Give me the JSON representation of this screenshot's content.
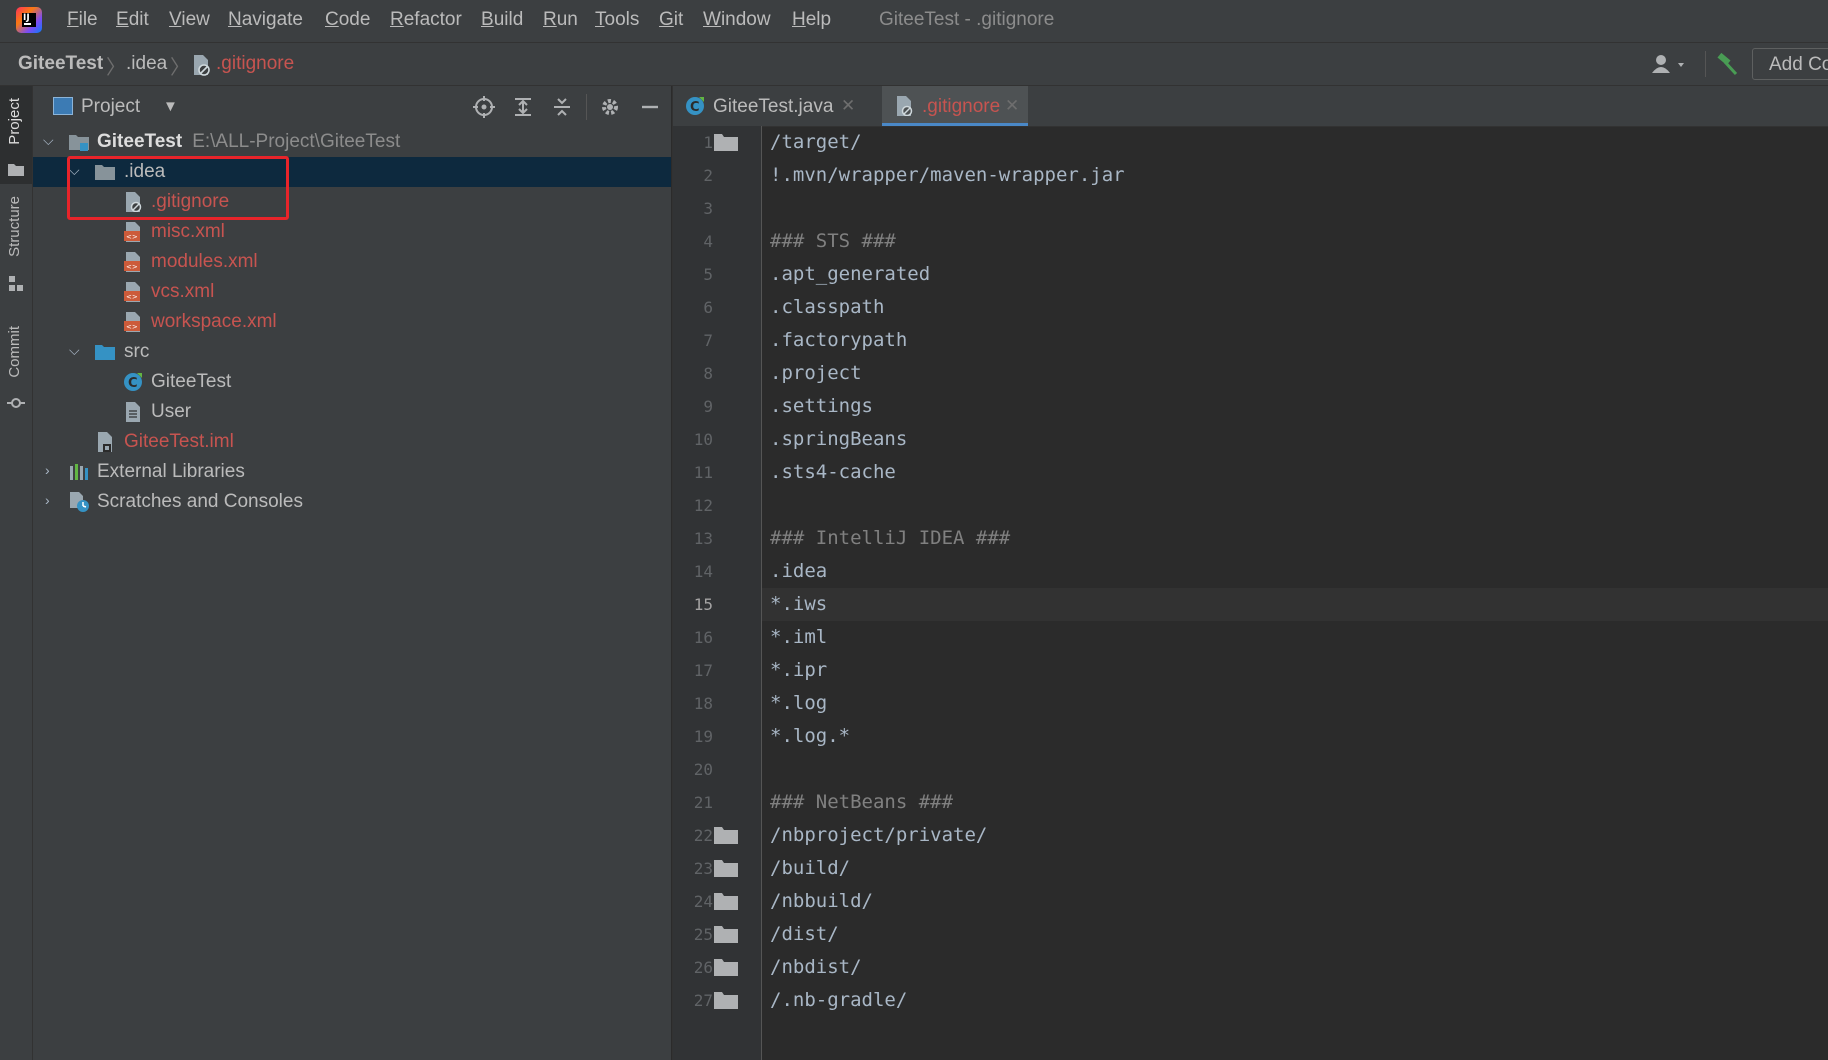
{
  "menubar": {
    "items": [
      {
        "mnemonic": "F",
        "rest": "ile"
      },
      {
        "mnemonic": "E",
        "rest": "dit"
      },
      {
        "mnemonic": "V",
        "rest": "iew"
      },
      {
        "mnemonic": "N",
        "rest": "avigate"
      },
      {
        "mnemonic": "C",
        "rest": "ode"
      },
      {
        "mnemonic": "R",
        "rest": "efactor"
      },
      {
        "mnemonic": "B",
        "rest": "uild"
      },
      {
        "mnemonic": "R",
        "rest": "un"
      },
      {
        "mnemonic": "T",
        "rest": "ools"
      },
      {
        "mnemonic": "G",
        "rest": "it"
      },
      {
        "mnemonic": "W",
        "rest": "indow"
      },
      {
        "mnemonic": "H",
        "rest": "elp"
      }
    ],
    "window_title": "GiteeTest - .gitignore"
  },
  "navbar": {
    "crumbs": [
      "GiteeTest",
      ".idea",
      ".gitignore"
    ],
    "add_config_label": "Add Co"
  },
  "tool_stripe": {
    "project": "Project",
    "structure": "Structure",
    "commit": "Commit"
  },
  "project_panel": {
    "title": "Project",
    "tree": [
      {
        "label": "GiteeTest",
        "path": "E:\\ALL-Project\\GiteeTest",
        "icon": "module-folder-icon"
      },
      {
        "label": ".idea",
        "icon": "folder-icon"
      },
      {
        "label": ".gitignore",
        "icon": "ignore-file-icon"
      },
      {
        "label": "misc.xml",
        "icon": "xml-file-icon"
      },
      {
        "label": "modules.xml",
        "icon": "xml-file-icon"
      },
      {
        "label": "vcs.xml",
        "icon": "xml-file-icon"
      },
      {
        "label": "workspace.xml",
        "icon": "xml-file-icon"
      },
      {
        "label": "src",
        "icon": "source-folder-icon"
      },
      {
        "label": "GiteeTest",
        "icon": "java-class-icon"
      },
      {
        "label": "User",
        "icon": "file-icon"
      },
      {
        "label": "GiteeTest.iml",
        "icon": "iml-file-icon"
      },
      {
        "label": "External Libraries",
        "icon": "libraries-icon"
      },
      {
        "label": "Scratches and Consoles",
        "icon": "scratches-icon"
      }
    ]
  },
  "editor": {
    "tabs": [
      {
        "label": "GiteeTest.java",
        "icon": "java-class-icon"
      },
      {
        "label": ".gitignore",
        "icon": "ignore-file-icon"
      }
    ],
    "current_line": 15,
    "lines": [
      "/target/",
      "!.mvn/wrapper/maven-wrapper.jar",
      "",
      "### STS ###",
      ".apt_generated",
      ".classpath",
      ".factorypath",
      ".project",
      ".settings",
      ".springBeans",
      ".sts4-cache",
      "",
      "### IntelliJ IDEA ###",
      ".idea",
      "*.iws",
      "*.iml",
      "*.ipr",
      "*.log",
      "*.log.*",
      "",
      "### NetBeans ###",
      "/nbproject/private/",
      "/build/",
      "/nbbuild/",
      "/dist/",
      "/nbdist/",
      "/.nb-gradle/"
    ],
    "line_numbers": [
      "1",
      "2",
      "3",
      "4",
      "5",
      "6",
      "7",
      "8",
      "9",
      "10",
      "11",
      "12",
      "13",
      "14",
      "15",
      "16",
      "17",
      "18",
      "19",
      "20",
      "21",
      "22",
      "23",
      "24",
      "25",
      "26",
      "27"
    ]
  }
}
